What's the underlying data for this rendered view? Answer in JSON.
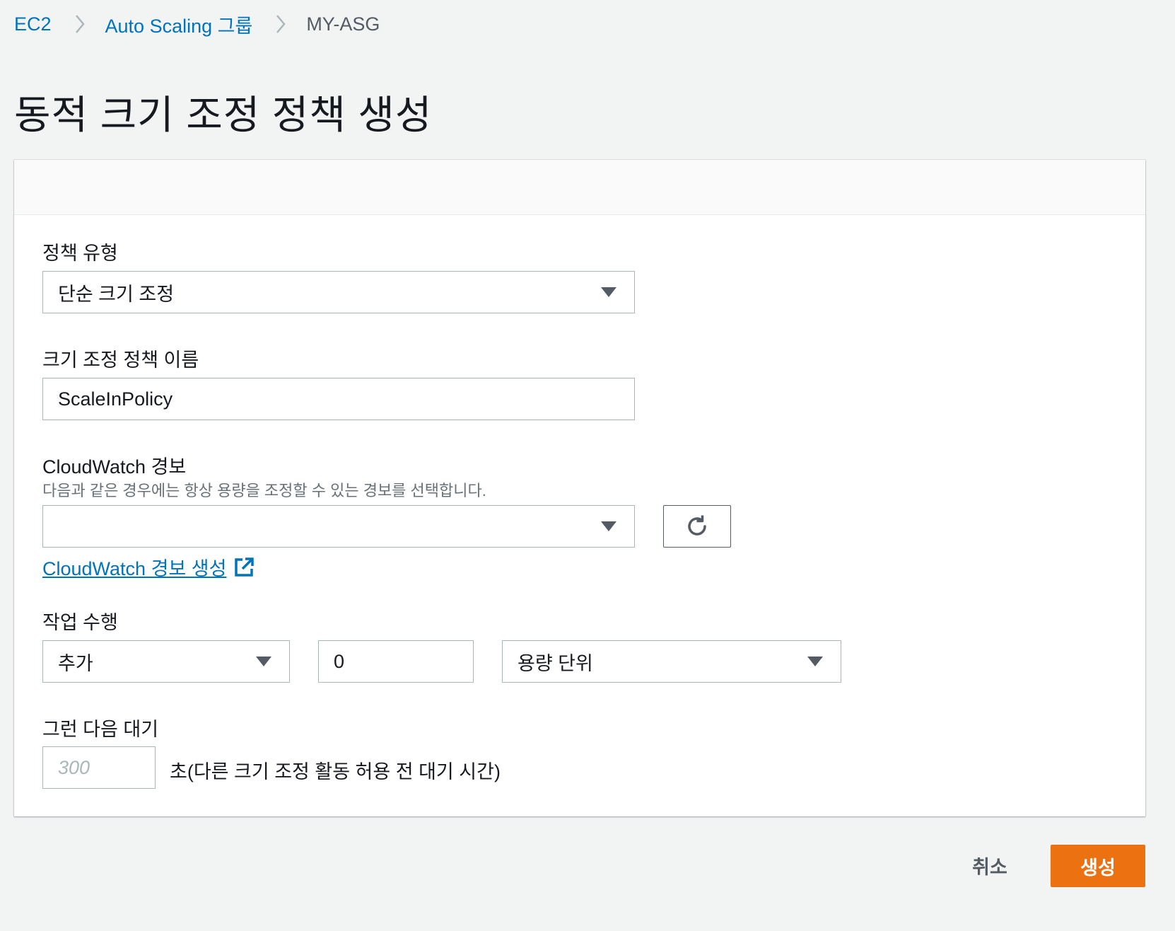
{
  "breadcrumb": {
    "items": [
      {
        "label": "EC2"
      },
      {
        "label": "Auto Scaling 그룹"
      },
      {
        "label": "MY-ASG"
      }
    ]
  },
  "page": {
    "title": "동적 크기 조정 정책 생성"
  },
  "form": {
    "policy_type": {
      "label": "정책 유형",
      "value": "단순 크기 조정"
    },
    "policy_name": {
      "label": "크기 조정 정책 이름",
      "value": "ScaleInPolicy"
    },
    "cloudwatch_alarm": {
      "label": "CloudWatch 경보",
      "description": "다음과 같은 경우에는 항상 용량을 조정할 수 있는 경보를 선택합니다.",
      "value": "",
      "create_link": "CloudWatch 경보 생성"
    },
    "take_action": {
      "label": "작업 수행",
      "action_value": "추가",
      "amount_value": "0",
      "unit_value": "용량 단위"
    },
    "wait": {
      "label": "그런 다음 대기",
      "placeholder": "300",
      "suffix": "초(다른 크기 조정 활동 허용 전 대기 시간)"
    }
  },
  "footer": {
    "cancel_label": "취소",
    "create_label": "생성"
  },
  "colors": {
    "link": "#0073bb",
    "primary_button": "#ec7211",
    "background": "#f2f3f3"
  },
  "icons": {
    "breadcrumb_separator": "chevron-right-icon",
    "dropdown": "caret-down-icon",
    "refresh": "refresh-icon",
    "external": "external-link-icon"
  }
}
